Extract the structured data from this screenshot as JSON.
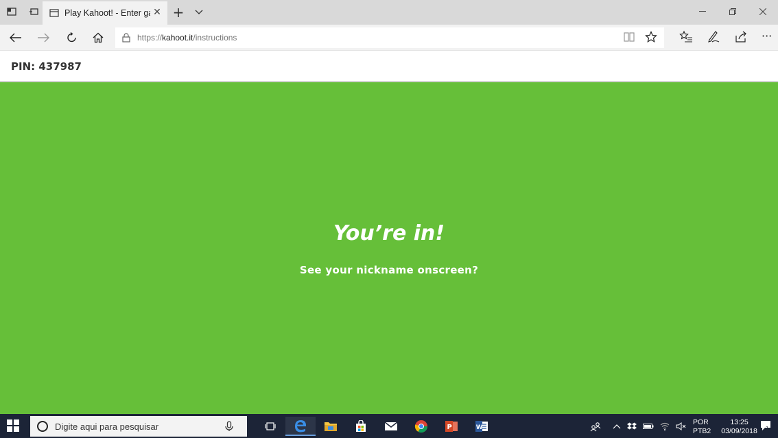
{
  "browser": {
    "tab": {
      "title": "Play Kahoot! - Enter gar"
    },
    "address": {
      "scheme": "https://",
      "host": "kahoot.it",
      "path": "/instructions"
    }
  },
  "page": {
    "pin_label": "PIN: 437987",
    "headline": "You’re in!",
    "subline": "See your nickname onscreen?",
    "background_color": "#66bf39"
  },
  "taskbar": {
    "search_placeholder": "Digite aqui para pesquisar",
    "lang_primary": "POR",
    "lang_secondary": "PTB2",
    "time": "13:25",
    "date": "03/09/2018",
    "apps": [
      "task-view-icon",
      "edge-icon",
      "file-explorer-icon",
      "store-icon",
      "mail-icon",
      "chrome-icon",
      "powerpoint-icon",
      "word-icon"
    ]
  }
}
